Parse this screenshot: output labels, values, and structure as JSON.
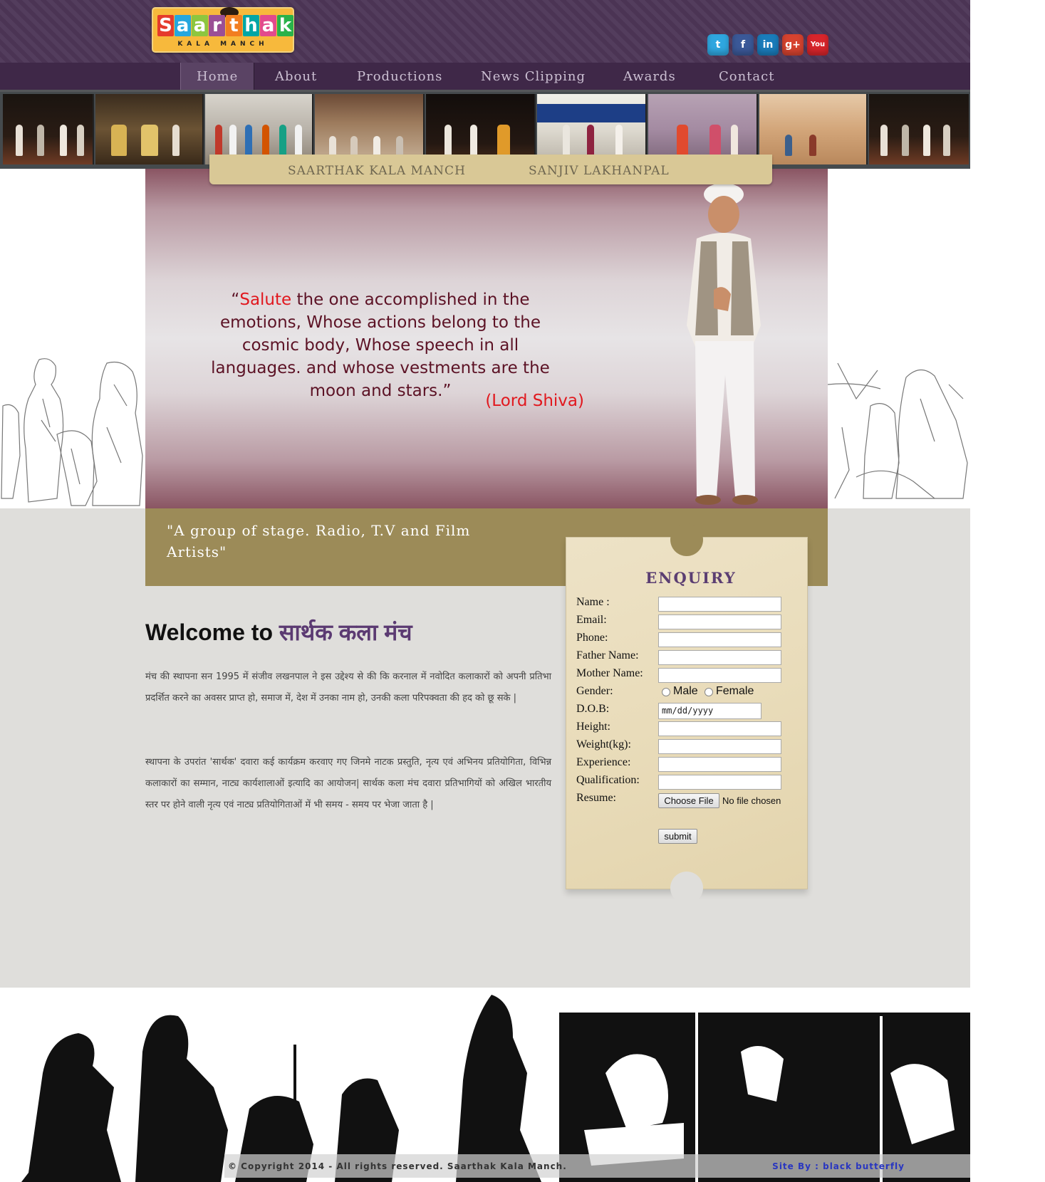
{
  "logo": {
    "word_letters": [
      "S",
      "a",
      "a",
      "r",
      "t",
      "h",
      "a",
      "k"
    ],
    "letter_colors": [
      "#e53b2c",
      "#26a7de",
      "#8dc63f",
      "#9b4f96",
      "#f27e20",
      "#00a6a6",
      "#e24a8d",
      "#2ab24a"
    ],
    "subtitle": "KALA MANCH"
  },
  "social": [
    {
      "name": "twitter",
      "glyph": "t",
      "color": "#2fa7e0"
    },
    {
      "name": "facebook",
      "glyph": "f",
      "color": "#3b5998"
    },
    {
      "name": "linkedin",
      "glyph": "in",
      "color": "#1a7cbb"
    },
    {
      "name": "google-plus",
      "glyph": "g+",
      "color": "#d6432f"
    },
    {
      "name": "youtube",
      "glyph": "You",
      "color": "#d8252b"
    }
  ],
  "nav": {
    "items": [
      {
        "label": "Home",
        "active": true
      },
      {
        "label": "About"
      },
      {
        "label": "Productions"
      },
      {
        "label": "News Clipping"
      },
      {
        "label": "Awards"
      },
      {
        "label": "Contact"
      }
    ]
  },
  "tabs": [
    "SAARTHAK KALA MANCH",
    "SANJIV LAKHANPAL"
  ],
  "hero": {
    "quote_open": "“",
    "quote_highlight": "Salute",
    "quote_rest": " the one accomplished in the emotions, Whose actions belong to the cosmic body, Whose speech in all languages. and whose vestments are the moon and stars.”",
    "attribution": "(Lord Shiva)"
  },
  "tagline": "\"A group of stage. Radio, T.V and Film Artists\"",
  "welcome": {
    "prefix": "Welcome to ",
    "hindi": "सार्थक कला मंच"
  },
  "paragraphs": [
    "मंच की स्थापना सन 1995 में संजीव लखनपाल ने इस उद्देश्य से की कि करनाल में नवोदित कलाकारों को अपनी प्रतिभा प्रदर्शित करने का अवसर प्राप्त हो, समाज में, देश में उनका नाम हो, उनकी कला परिपक्वता की हद को छू सके |",
    "स्थापना के उपरांत 'सार्थक' दवारा कई कार्यक्रम करवाए गए जिनमे नाटक प्रस्तुति, नृत्य एवं अभिनय प्रतियोगिता, विभिन्न कलाकारों का सम्मान, नाट्य कार्यशालाओं इत्यादि का आयोजन| सार्थक कला मंच दवारा प्रतिभागियों को अखिल भारतीय स्तर पर होने वाली नृत्य एवं नाट्य प्रतियोगिताओं में भी समय - समय पर भेजा जाता है |"
  ],
  "enquiry": {
    "title": "ENQUIRY",
    "labels": {
      "name": "Name :",
      "email": "Email:",
      "phone": "Phone:",
      "father": "Father Name:",
      "mother": "Mother Name:",
      "gender": "Gender:",
      "dob": "D.O.B:",
      "height": "Height:",
      "weight": "Weight(kg):",
      "experience": "Experience:",
      "qualification": "Qualification:",
      "resume": "Resume:"
    },
    "gender_options": [
      "Male",
      "Female"
    ],
    "dob_placeholder": "mm/dd/yyyy",
    "choose_file": "Choose File",
    "no_file": "No file chosen",
    "submit": "submit"
  },
  "footer": {
    "copyright": "© Copyright 2014 - All rights reserved. Saarthak Kala Manch.",
    "site_by": "Site By : black butterfly"
  }
}
